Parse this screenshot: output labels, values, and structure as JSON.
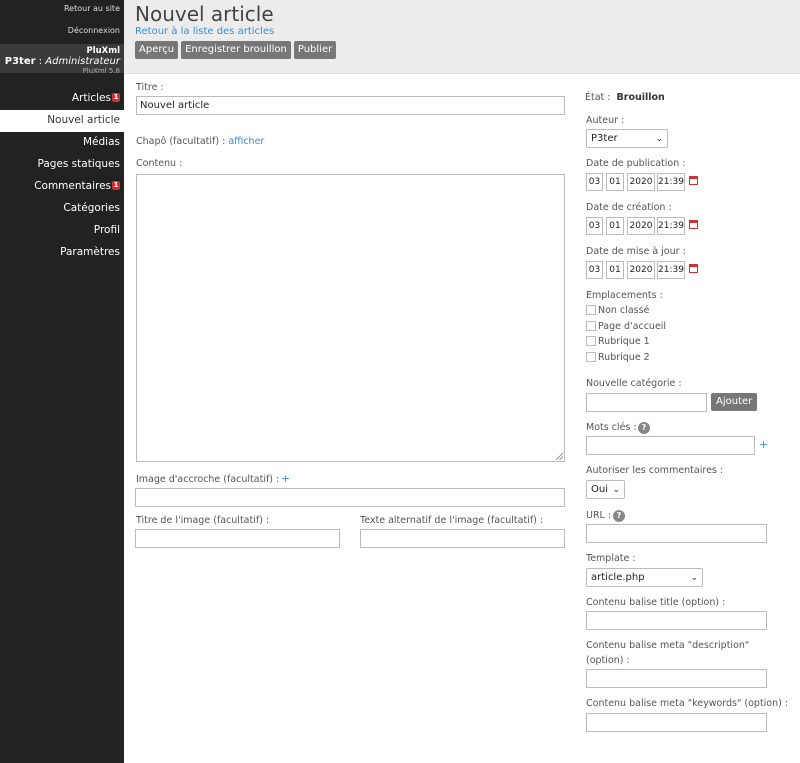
{
  "sidebar": {
    "back_to_site": "Retour au site",
    "logout": "Déconnexion",
    "app_name": "PluXml",
    "user_name": "P3ter",
    "user_role": "Administrateur",
    "version": "PluXml 5.8",
    "menu": [
      {
        "label": "Articles",
        "badge": "1"
      },
      {
        "label": "Nouvel article"
      },
      {
        "label": "Médias"
      },
      {
        "label": "Pages statiques"
      },
      {
        "label": "Commentaires",
        "badge": "1"
      },
      {
        "label": "Catégories"
      },
      {
        "label": "Profil"
      },
      {
        "label": "Paramètres"
      }
    ]
  },
  "header": {
    "title": "Nouvel article",
    "back_link": "Retour à la liste des articles",
    "buttons": {
      "preview": "Aperçu",
      "save_draft": "Enregistrer brouillon",
      "publish": "Publier"
    }
  },
  "main": {
    "title_label": "Titre :",
    "title_value": "Nouvel article",
    "chapo_label": "Chapô (facultatif) :",
    "chapo_link": "afficher",
    "content_label": "Contenu :",
    "image_label": "Image d'accroche (facultatif) :",
    "image_add": "+",
    "image_title_label": "Titre de l'image (facultatif) :",
    "image_alt_label": "Texte alternatif de l'image (facultatif) :"
  },
  "side": {
    "state_label": "État :",
    "state_value": "Brouillon",
    "author_label": "Auteur :",
    "author_value": "P3ter",
    "pub_date_label": "Date de publication :",
    "creation_date_label": "Date de création :",
    "update_date_label": "Date de mise à jour :",
    "date": {
      "day": "03",
      "month": "01",
      "year": "2020",
      "time": "21:39"
    },
    "locations_label": "Emplacements :",
    "locations": [
      "Non classé",
      "Page d'accueil",
      "Rubrique 1",
      "Rubrique 2"
    ],
    "new_category_label": "Nouvelle catégorie :",
    "add_button": "Ajouter",
    "keywords_label": "Mots clés :",
    "help": "?",
    "plus": "+",
    "allow_comments_label": "Autoriser les commentaires :",
    "allow_comments_value": "Oui",
    "url_label": "URL :",
    "template_label": "Template :",
    "template_value": "article.php",
    "meta_title_label": "Contenu balise title (option) :",
    "meta_desc_label_1": "Contenu balise meta \"description\"",
    "meta_desc_label_2": "(option) :",
    "meta_keywords_label": "Contenu balise meta \"keywords\" (option) :"
  }
}
